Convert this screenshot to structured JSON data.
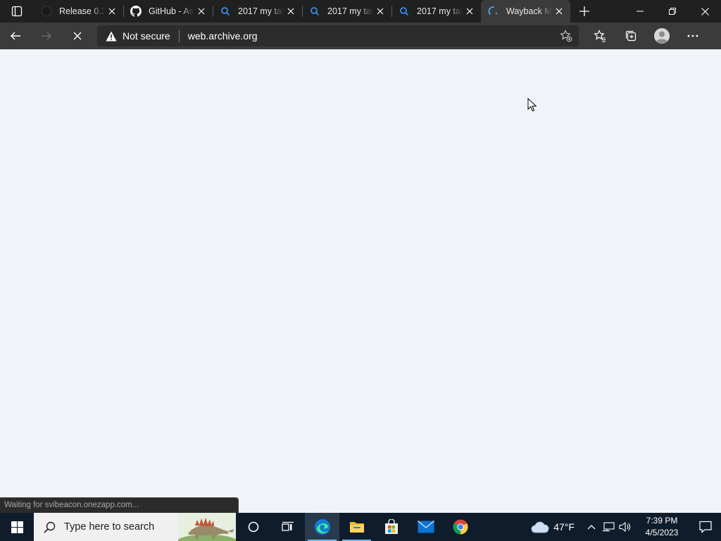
{
  "browser": {
    "tabs": [
      {
        "title": "Release 0.2.",
        "favicon": "github-dark-icon",
        "active": false
      },
      {
        "title": "GitHub - As",
        "favicon": "github-icon",
        "active": false
      },
      {
        "title": "2017 my tal",
        "favicon": "search-icon",
        "active": false
      },
      {
        "title": "2017 my tal",
        "favicon": "search-icon",
        "active": false
      },
      {
        "title": "2017 my tal",
        "favicon": "search-icon",
        "active": false
      },
      {
        "title": "Wayback M",
        "favicon": "loading-spinner-icon",
        "active": true
      }
    ],
    "address": {
      "security_label": "Not secure",
      "url": "web.archive.org"
    },
    "status_text": "Waiting for svibeacon.onezapp.com..."
  },
  "taskbar": {
    "search_placeholder": "Type here to search",
    "apps": [
      "cortana-icon",
      "task-view-icon",
      "edge-icon",
      "file-explorer-icon",
      "microsoft-store-icon",
      "mail-icon",
      "chrome-icon"
    ],
    "weather": {
      "temp": "47°F",
      "icon": "cloud-icon"
    },
    "clock": {
      "time": "7:39 PM",
      "date": "4/5/2023"
    }
  },
  "colors": {
    "tabstrip_bg": "#202020",
    "toolbar_bg": "#3b3b3b",
    "content_bg": "#f0f4fa",
    "taskbar_bg": "#0f1c2c",
    "accent": "#76b9ed"
  }
}
